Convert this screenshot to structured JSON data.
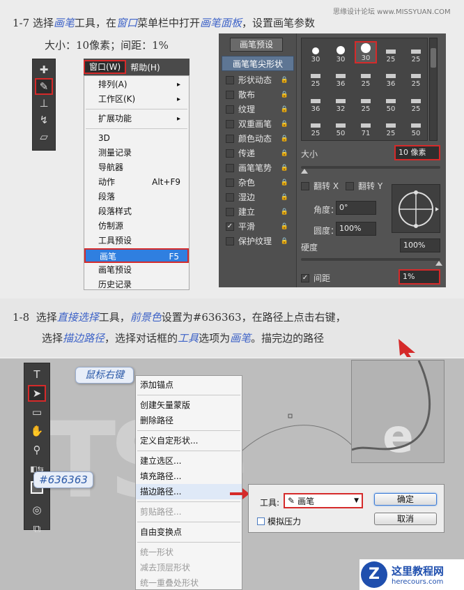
{
  "watermark": "思缘设计论坛 www.MISSYUAN.COM",
  "step17": {
    "number": "1-7",
    "p1": "选择",
    "h1": "画笔",
    "p2": "工具，在",
    "h2": "窗口",
    "p3": "菜单栏中打开",
    "h3": "画笔面板",
    "p4": "，设置画笔参数",
    "line2": "大小：10像素；间距：1%"
  },
  "menubar": {
    "window": "窗口(W)",
    "help": "帮助(H)"
  },
  "window_menu": [
    {
      "label": "排列(A)",
      "sub": true
    },
    {
      "label": "工作区(K)",
      "sub": true
    },
    {
      "sep": true
    },
    {
      "label": "扩展功能",
      "sub": true
    },
    {
      "sep": true
    },
    {
      "label": "3D"
    },
    {
      "label": "测量记录"
    },
    {
      "label": "导航器"
    },
    {
      "label": "动作",
      "shortcut": "Alt+F9"
    },
    {
      "label": "段落"
    },
    {
      "label": "段落样式"
    },
    {
      "label": "仿制源"
    },
    {
      "label": "工具预设"
    },
    {
      "label": "画笔",
      "shortcut": "F5",
      "highlight": true
    },
    {
      "label": "画笔预设"
    },
    {
      "label": "历史记录"
    }
  ],
  "brush_panel": {
    "preset_button": "画笔预设",
    "tip_shape": "画笔笔尖形状",
    "options": [
      {
        "label": "形状动态",
        "checked": false
      },
      {
        "label": "散布",
        "checked": false
      },
      {
        "label": "纹理",
        "checked": false
      },
      {
        "label": "双重画笔",
        "checked": false
      },
      {
        "label": "颜色动态",
        "checked": false
      },
      {
        "label": "传递",
        "checked": false
      },
      {
        "label": "画笔笔势",
        "checked": false
      },
      {
        "label": "杂色",
        "checked": false
      },
      {
        "label": "湿边",
        "checked": false
      },
      {
        "label": "建立",
        "checked": false
      },
      {
        "label": "平滑",
        "checked": true
      },
      {
        "label": "保护纹理",
        "checked": false
      }
    ],
    "brush_sizes": [
      "30",
      "30",
      "30",
      "25",
      "25",
      "25",
      "36",
      "25",
      "36",
      "25",
      "36",
      "32",
      "25",
      "50",
      "25",
      "25",
      "50",
      "71",
      "25",
      "50"
    ],
    "size_label": "大小",
    "size_value": "10 像素",
    "flip_x": "翻转 X",
    "flip_y": "翻转 Y",
    "angle_label": "角度：",
    "angle_value": "0°",
    "roundness_label": "圆度：",
    "roundness_value": "100%",
    "hardness_label": "硬度",
    "hardness_value": "100%",
    "spacing_label": "间距",
    "spacing_value": "1%"
  },
  "step18": {
    "number": "1-8",
    "p1": "选择",
    "h1": "直接选择",
    "p2": "工具，",
    "h2": "前景色",
    "p3": "设置为#636363，在路径上点击右键，",
    "p4": "选择",
    "h3": "描边路径",
    "p5": "，选择对话框的",
    "h4": "工具",
    "p6": "选项为",
    "h5": "画笔",
    "p7": "。描完边的路径"
  },
  "callout_right_click": "鼠标右键",
  "callout_color": "#636363",
  "context_menu": [
    {
      "label": "添加锚点"
    },
    {
      "sep": true
    },
    {
      "label": "创建矢量蒙版"
    },
    {
      "label": "删除路径"
    },
    {
      "sep": true
    },
    {
      "label": "定义自定形状..."
    },
    {
      "sep": true
    },
    {
      "label": "建立选区..."
    },
    {
      "label": "填充路径..."
    },
    {
      "label": "描边路径...",
      "hover": true
    },
    {
      "sep": true
    },
    {
      "label": "剪贴路径...",
      "disabled": true
    },
    {
      "sep": true
    },
    {
      "label": "自由变换点"
    },
    {
      "sep": true
    },
    {
      "label": "统一形状",
      "disabled": true
    },
    {
      "label": "减去顶层形状",
      "disabled": true
    },
    {
      "label": "统一重叠处形状",
      "disabled": true
    }
  ],
  "stroke_dialog": {
    "tool_label": "工具:",
    "tool_value": "画笔",
    "simulate_pressure": "模拟压力",
    "ok": "确定",
    "cancel": "取消"
  },
  "logo": {
    "name": "这里教程网",
    "url": "herecours.com"
  }
}
